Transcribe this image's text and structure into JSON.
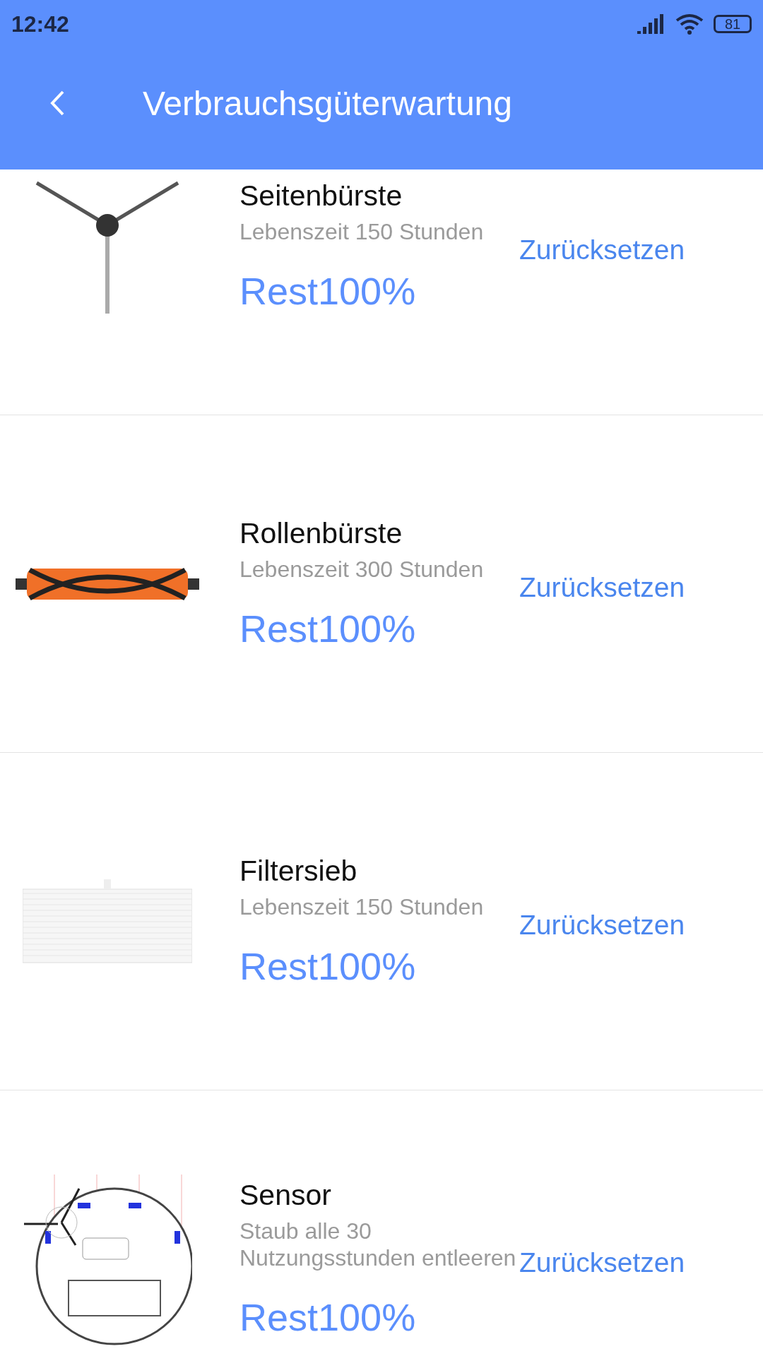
{
  "status_bar": {
    "time": "12:42",
    "battery": "81"
  },
  "header": {
    "title": "Verbrauchsgüterwartung"
  },
  "items": [
    {
      "kind": "side_brush",
      "name": "Seitenbürste",
      "description": "Lebenszeit 150 Stunden",
      "remaining": "Rest100%",
      "action": "Zurücksetzen"
    },
    {
      "kind": "roller_brush",
      "name": "Rollenbürste",
      "description": "Lebenszeit 300 Stunden",
      "remaining": "Rest100%",
      "action": "Zurücksetzen"
    },
    {
      "kind": "filter",
      "name": "Filtersieb",
      "description": "Lebenszeit 150 Stunden",
      "remaining": "Rest100%",
      "action": "Zurücksetzen"
    },
    {
      "kind": "sensor",
      "name": "Sensor",
      "description": "Staub alle 30 Nutzungsstunden entleeren",
      "remaining": "Rest100%",
      "action": "Zurücksetzen"
    }
  ]
}
